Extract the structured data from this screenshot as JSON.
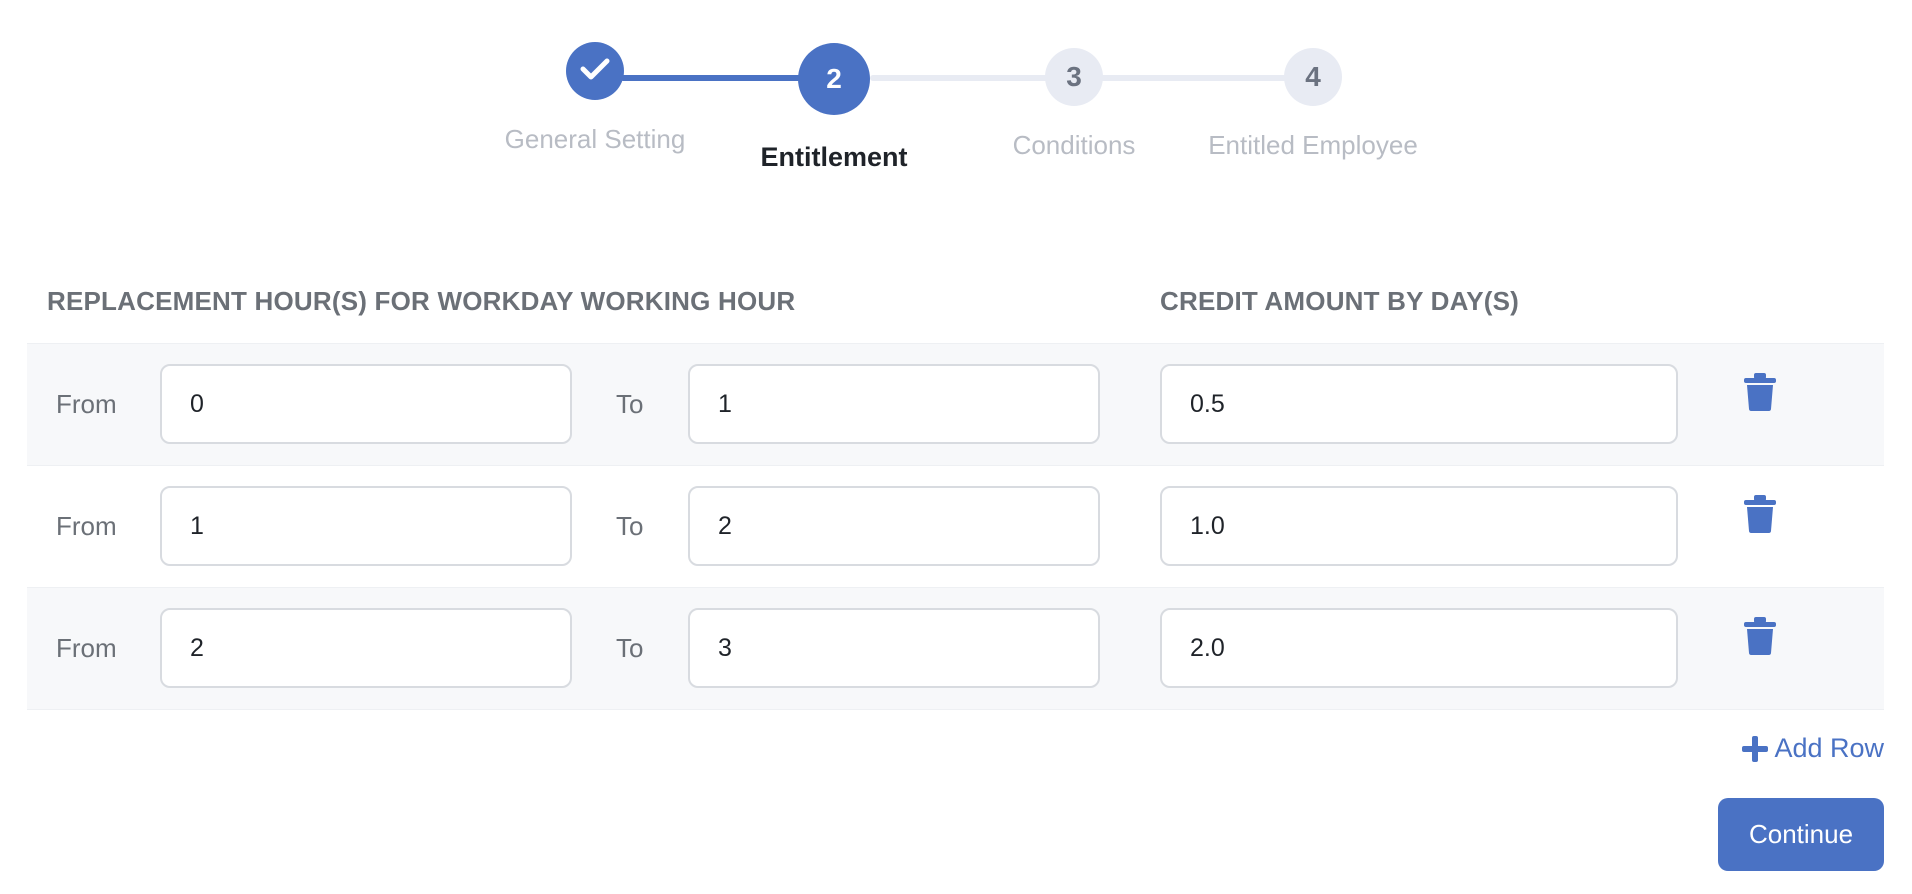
{
  "stepper": {
    "steps": [
      {
        "number": "",
        "label": "General Setting",
        "state": "completed",
        "icon": "check-icon"
      },
      {
        "number": "2",
        "label": "Entitlement",
        "state": "active"
      },
      {
        "number": "3",
        "label": "Conditions",
        "state": "pending"
      },
      {
        "number": "4",
        "label": "Entitled Employee",
        "state": "pending"
      }
    ]
  },
  "headers": {
    "replacement": "REPLACEMENT HOUR(S) FOR WORKDAY WORKING HOUR",
    "credit": "CREDIT AMOUNT BY DAY(S)"
  },
  "rows": [
    {
      "from_label": "From",
      "from": "0",
      "to_label": "To",
      "to": "1",
      "credit": "0.5",
      "delete_icon": "trash-icon"
    },
    {
      "from_label": "From",
      "from": "1",
      "to_label": "To",
      "to": "2",
      "credit": "1.0",
      "delete_icon": "trash-icon"
    },
    {
      "from_label": "From",
      "from": "2",
      "to_label": "To",
      "to": "3",
      "credit": "2.0",
      "delete_icon": "trash-icon"
    }
  ],
  "actions": {
    "add_row": "Add Row",
    "add_row_icon": "plus-icon",
    "continue": "Continue"
  },
  "colors": {
    "accent": "#4a72c4",
    "pending_step": "#e8ebf3",
    "row_shade": "#f7f8fa"
  }
}
